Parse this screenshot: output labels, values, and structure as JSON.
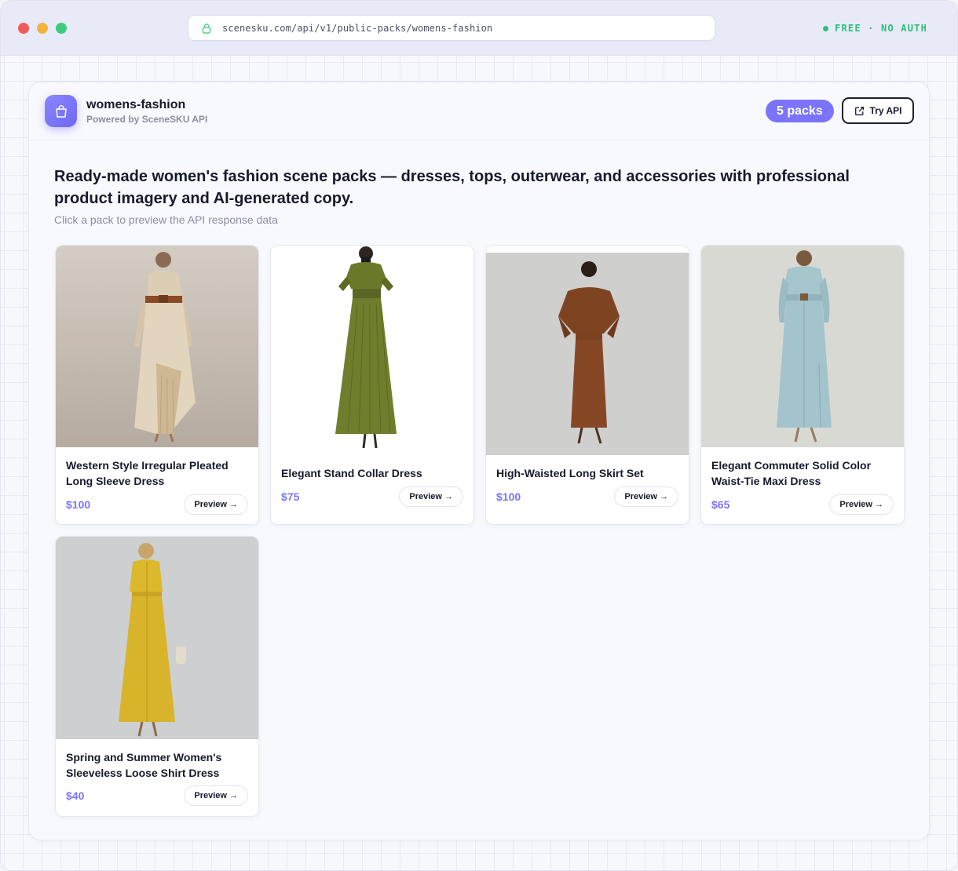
{
  "browser": {
    "url": "scenesku.com/api/v1/public-packs/womens-fashion",
    "status_badge": "FREE · NO AUTH"
  },
  "header": {
    "title": "womens-fashion",
    "subtitle": "Powered by SceneSKU API",
    "packs_count": "5 packs",
    "try_api_label": "Try API"
  },
  "intro": {
    "headline": "Ready-made women's fashion scene packs — dresses, tops, outerwear, and accessories with professional product imagery and AI-generated copy.",
    "hint": "Click a pack to preview the API response data"
  },
  "products": [
    {
      "name": "Western Style Irregular Pleated Long Sleeve Dress",
      "price": "$100",
      "preview_label": "Preview →",
      "dress_color": "#d9c9b0"
    },
    {
      "name": "Elegant Stand Collar Dress",
      "price": "$75",
      "preview_label": "Preview →",
      "dress_color": "#6b7a2a"
    },
    {
      "name": "High-Waisted Long Skirt Set",
      "price": "$100",
      "preview_label": "Preview →",
      "dress_color": "#8a4a24"
    },
    {
      "name": "Elegant Commuter Solid Color Waist-Tie Maxi Dress",
      "price": "$65",
      "preview_label": "Preview →",
      "dress_color": "#9fc2cc"
    },
    {
      "name": "Spring and Summer Women's Sleeveless Loose Shirt Dress",
      "price": "$40",
      "preview_label": "Preview →",
      "dress_color": "#d9b52a"
    }
  ],
  "colors": {
    "accent": "#7b74fb",
    "free_green": "#2bbf7a"
  },
  "icons": [
    "lock-icon",
    "shopping-bag-icon",
    "external-link-icon"
  ]
}
